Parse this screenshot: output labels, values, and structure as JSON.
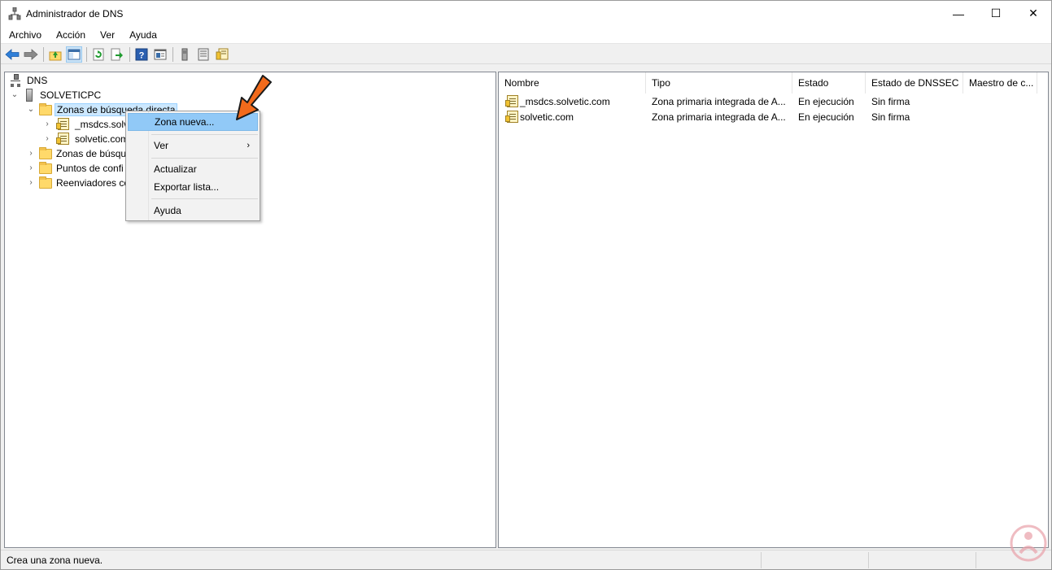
{
  "window": {
    "title": "Administrador de DNS",
    "controls": {
      "minimize": "—",
      "maximize": "☐",
      "close": "✕"
    }
  },
  "menubar": {
    "items": [
      "Archivo",
      "Acción",
      "Ver",
      "Ayuda"
    ]
  },
  "toolbar": {
    "buttons": [
      "back-icon",
      "forward-icon",
      "up-folder-icon",
      "show-hide-tree-icon",
      "refresh-icon",
      "export-icon",
      "help-icon",
      "properties-icon",
      "server-icon",
      "list-icon",
      "zone-icon"
    ]
  },
  "tree": {
    "root": "DNS",
    "server": "SOLVETICPC",
    "forward_zones": "Zonas de búsqueda directa",
    "zone1": "_msdcs.solve",
    "zone2": "solvetic.com",
    "reverse_zones": "Zonas de búsqu",
    "trust_points": "Puntos de confi",
    "forwarders": "Reenviadores co"
  },
  "context_menu": {
    "new_zone": "Zona nueva...",
    "view": "Ver",
    "view_arrow": "›",
    "refresh": "Actualizar",
    "export": "Exportar lista...",
    "help": "Ayuda"
  },
  "list": {
    "columns": [
      "Nombre",
      "Tipo",
      "Estado",
      "Estado de DNSSEC",
      "Maestro de c..."
    ],
    "rows": [
      {
        "name": "_msdcs.solvetic.com",
        "type": "Zona primaria integrada de A...",
        "state": "En ejecución",
        "dnssec": "Sin firma",
        "master": ""
      },
      {
        "name": "solvetic.com",
        "type": "Zona primaria integrada de A...",
        "state": "En ejecución",
        "dnssec": "Sin firma",
        "master": ""
      }
    ]
  },
  "statusbar": {
    "text": "Crea una zona nueva."
  },
  "colors": {
    "highlight": "#91c9f7",
    "annotation_arrow": "#f26a1b",
    "watermark": "#e8a0a8"
  }
}
